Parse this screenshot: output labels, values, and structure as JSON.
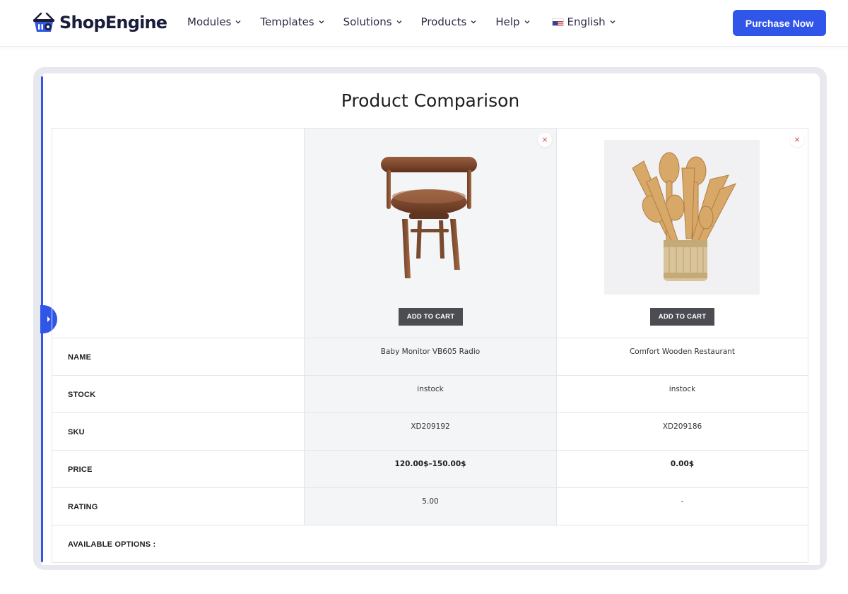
{
  "header": {
    "brand": "ShopEngine",
    "nav": [
      {
        "label": "Modules"
      },
      {
        "label": "Templates"
      },
      {
        "label": "Solutions"
      },
      {
        "label": "Products"
      },
      {
        "label": "Help"
      }
    ],
    "language": "English",
    "purchase_label": "Purchase Now",
    "accent_color": "#2f56e8"
  },
  "comparison": {
    "title": "Product Comparison",
    "add_to_cart_label": "ADD TO CART",
    "remove_symbol": "×",
    "rows": {
      "name": "NAME",
      "stock": "STOCK",
      "sku": "SKU",
      "price": "PRICE",
      "rating": "RATING",
      "options": "AVAILABLE OPTIONS :"
    },
    "products": [
      {
        "image": "wooden-leather-chair",
        "name": "Baby Monitor VB605 Radio",
        "stock": "instock",
        "sku": "XD209192",
        "price": "120.00$–150.00$",
        "rating": "5.00"
      },
      {
        "image": "wooden-utensils-jar",
        "name": "Comfort Wooden Restaurant",
        "stock": "instock",
        "sku": "XD209186",
        "price": "0.00$",
        "rating": "-"
      }
    ]
  }
}
